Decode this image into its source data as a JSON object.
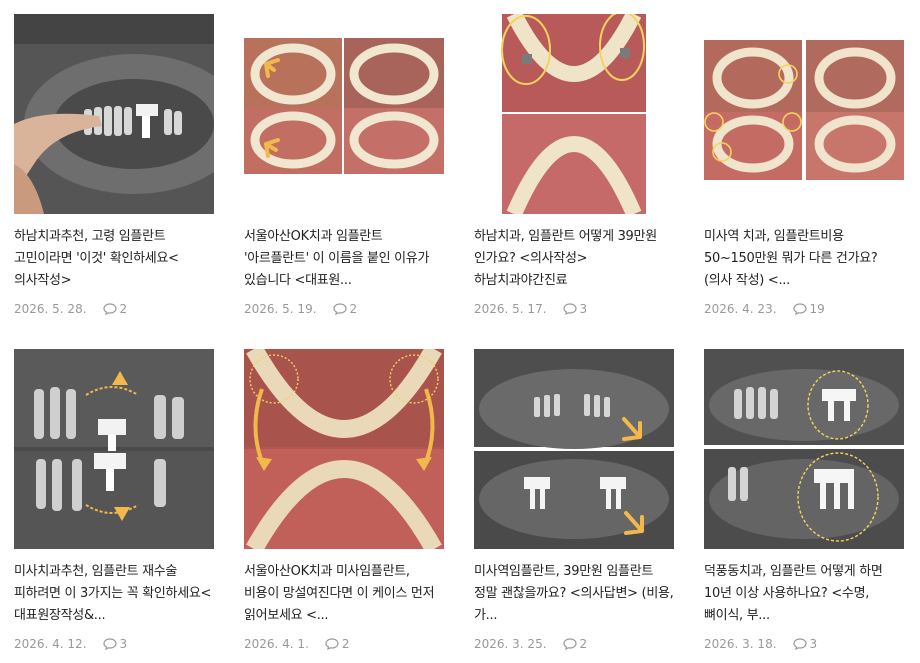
{
  "posts": [
    {
      "title": "하남치과추천, 고령 임플란트 고민이라면 '이것' 확인하세요<의사작성>",
      "date": "2026. 5. 28.",
      "comments": "2",
      "image": "panoramic-xray-with-hand"
    },
    {
      "title": "서울아산OK치과 임플란트 '아르플란트' 이 이름을 붙인 이유가 있습니다 <대표원...",
      "date": "2026. 5. 19.",
      "comments": "2",
      "image": "dental-arch-photos-arrows"
    },
    {
      "title": "하남치과, 임플란트 어떻게 39만원 인가요? <의사작성> 하남치과야간진료",
      "date": "2026. 5. 17.",
      "comments": "3",
      "image": "dental-arch-photos-circles"
    },
    {
      "title": "미사역 치과, 임플란트비용 50~150만원 뭐가 다른 건가요? (의사 작성) <...",
      "date": "2026. 4. 23.",
      "comments": "19",
      "image": "dental-arch-quad-photos"
    },
    {
      "title": "미사치과추천, 임플란트 재수술 피하려면 이 3가지는 꼭 확인하세요<대표원장작성&...",
      "date": "2026. 4. 12.",
      "comments": "3",
      "image": "xray-implant-arrows"
    },
    {
      "title": "서울아산OK치과 미사임플란트, 비용이 망설여진다면 이 케이스 먼저 읽어보세요 <...",
      "date": "2026. 4. 1.",
      "comments": "2",
      "image": "dental-arch-curved-arrows"
    },
    {
      "title": "미사역임플란트, 39만원 임플란트 정말 괜찮을까요? <의사답변> (비용, 가...",
      "date": "2026. 3. 25.",
      "comments": "2",
      "image": "panoramic-before-after"
    },
    {
      "title": "덕풍동치과, 임플란트 어떻게 하면 10년 이상 사용하나요? <수명, 뼈이식, 부...",
      "date": "2026. 3. 18.",
      "comments": "3",
      "image": "panoramic-implants-circled"
    }
  ],
  "colors": {
    "date": "#999999",
    "title": "#222222",
    "accent": "#f2b84b"
  },
  "icons": {
    "comment": "speech-bubble-icon"
  }
}
